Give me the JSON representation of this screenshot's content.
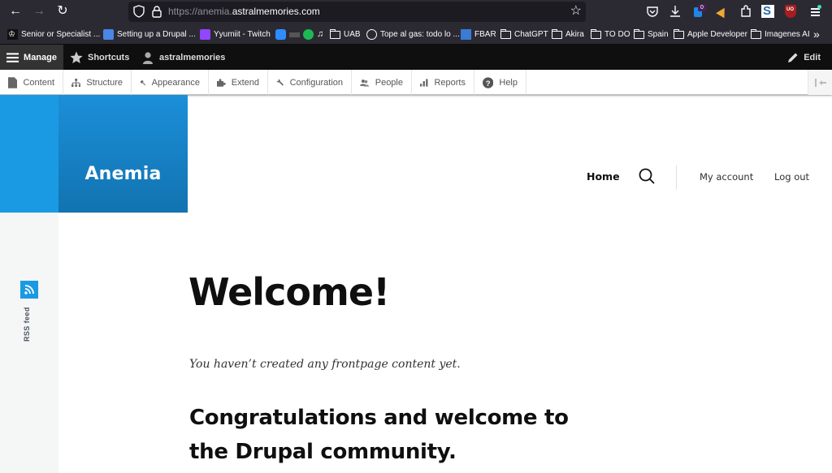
{
  "browser": {
    "url_prefix": "https://anemia.",
    "url_domain": "astralmemories.com",
    "badge_count": "0",
    "bookmarks": [
      {
        "label": "Senior or Specialist ...",
        "icon": "crown-icon"
      },
      {
        "label": "Setting up a Drupal ...",
        "icon": "docs-icon"
      },
      {
        "label": "Yyumiit - Twitch",
        "icon": "twitch-icon"
      },
      {
        "label": "",
        "icon": "zoom-icon"
      },
      {
        "label": "",
        "icon": "spotify-icon"
      },
      {
        "label": "UAB",
        "icon": "folder-icon"
      },
      {
        "label": "Tope al gas: todo lo ...",
        "icon": "globe-icon"
      },
      {
        "label": "FBAR",
        "icon": "fbar-icon"
      },
      {
        "label": "ChatGPT",
        "icon": "folder-icon"
      },
      {
        "label": "Akira",
        "icon": "folder-icon"
      },
      {
        "label": "TO DO",
        "icon": "folder-icon"
      },
      {
        "label": "Spain",
        "icon": "folder-icon"
      },
      {
        "label": "Apple Developer",
        "icon": "folder-icon"
      },
      {
        "label": "Imagenes AI",
        "icon": "folder-icon"
      }
    ],
    "overflow": "»"
  },
  "toolbar": {
    "manage": "Manage",
    "shortcuts": "Shortcuts",
    "user": "astralmemories",
    "edit": "Edit"
  },
  "tray": {
    "items": [
      {
        "label": "Content",
        "icon": "file-icon"
      },
      {
        "label": "Structure",
        "icon": "sitemap-icon"
      },
      {
        "label": "Appearance",
        "icon": "paint-icon"
      },
      {
        "label": "Extend",
        "icon": "puzzle-icon"
      },
      {
        "label": "Configuration",
        "icon": "wrench-icon"
      },
      {
        "label": "People",
        "icon": "people-icon"
      },
      {
        "label": "Reports",
        "icon": "bar-chart-icon"
      },
      {
        "label": "Help",
        "icon": "help-icon"
      }
    ]
  },
  "site": {
    "name": "Anemia",
    "nav": {
      "home": "Home"
    },
    "account": {
      "my_account": "My account",
      "log_out": "Log out"
    },
    "rss_label": "RSS feed",
    "colors": {
      "brand": "#1b9ae4",
      "brand_dark": "#1273b0"
    }
  },
  "content": {
    "title": "Welcome!",
    "intro": "You haven’t created any frontpage content yet.",
    "subtitle": "Congratulations and welcome to the Drupal community."
  }
}
